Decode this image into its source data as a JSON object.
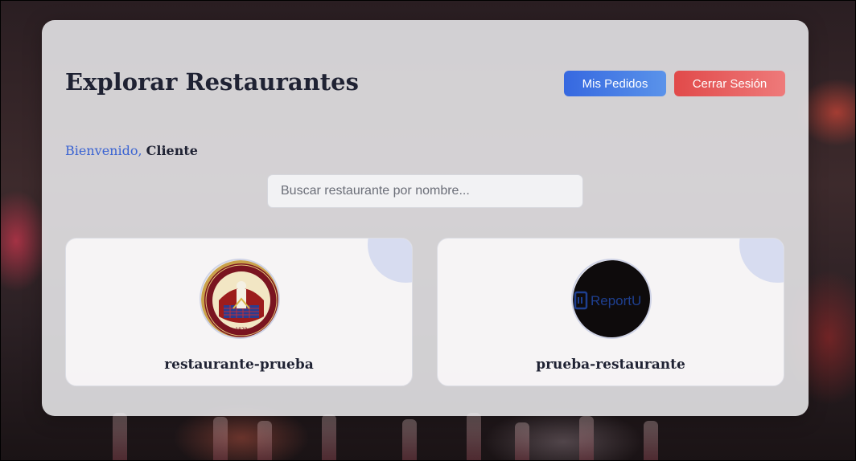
{
  "header": {
    "title": "Explorar Restaurantes",
    "orders_label": "Mis Pedidos",
    "logout_label": "Cerrar Sesión"
  },
  "welcome": {
    "label": "Bienvenido,",
    "user": "Cliente"
  },
  "search": {
    "placeholder": "Buscar restaurante por nombre...",
    "value": ""
  },
  "restaurants": [
    {
      "name": "restaurante-prueba",
      "logo_icon": "university-seal-logo"
    },
    {
      "name": "prueba-restaurante",
      "logo_icon": "reportu-logo",
      "logo_text": "ReportU"
    }
  ],
  "colors": {
    "primary": "#3668e0",
    "danger": "#e14a4a",
    "title": "#1f2233",
    "accent_text": "#3a63d2"
  }
}
